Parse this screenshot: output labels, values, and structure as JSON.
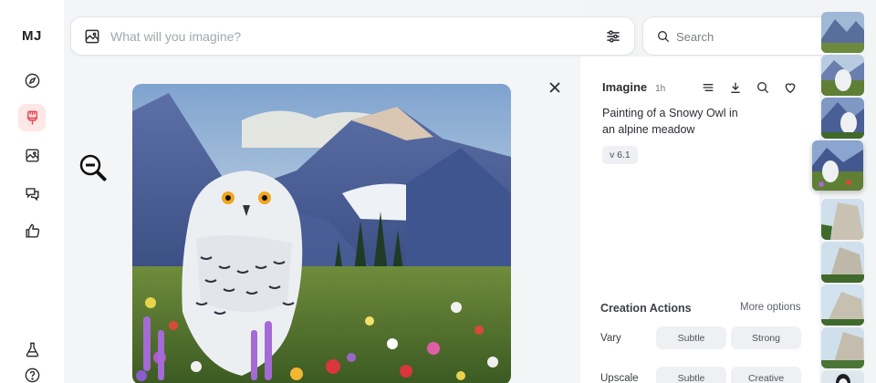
{
  "sidebar": {
    "logo": "MJ",
    "items": [
      {
        "name": "explore",
        "icon": "compass-icon"
      },
      {
        "name": "create",
        "icon": "paintbrush-icon",
        "active": true
      },
      {
        "name": "organize",
        "icon": "image-icon"
      },
      {
        "name": "chat",
        "icon": "chat-bubbles-icon"
      },
      {
        "name": "rate",
        "icon": "thumbs-up-icon"
      },
      {
        "name": "lab",
        "icon": "flask-icon"
      },
      {
        "name": "help",
        "icon": "help-icon"
      }
    ],
    "accent": "#e5484d"
  },
  "prompt_bar": {
    "placeholder": "What will you imagine?",
    "image_icon": "image-icon",
    "settings_icon": "sliders-icon"
  },
  "search": {
    "placeholder": "Search",
    "icon": "search-icon"
  },
  "viewer": {
    "zoom_icon": "zoom-out-icon",
    "close_icon": "close-icon"
  },
  "detail": {
    "title": "Imagine",
    "time": "1h",
    "actions": [
      "menu-icon",
      "download-icon",
      "search-icon",
      "heart-icon"
    ],
    "prompt": "Painting of a Snowy Owl in an alpine meadow",
    "version": "v 6.1",
    "creation_actions": {
      "title": "Creation Actions",
      "more": "More options",
      "rows": [
        {
          "label": "Vary",
          "buttons": [
            "Subtle",
            "Strong"
          ]
        },
        {
          "label": "Upscale",
          "buttons": [
            "Subtle",
            "Creative"
          ]
        }
      ]
    }
  },
  "thumbnails": [
    {
      "subject": "mountain-painting"
    },
    {
      "subject": "owl-meadow"
    },
    {
      "subject": "owl-mountains"
    },
    {
      "subject": "owl-meadow",
      "selected": true
    },
    {
      "subject": "granite-cliff"
    },
    {
      "subject": "granite-cliff"
    },
    {
      "subject": "granite-cliff"
    },
    {
      "subject": "granite-cliff"
    },
    {
      "subject": "penguin"
    }
  ]
}
